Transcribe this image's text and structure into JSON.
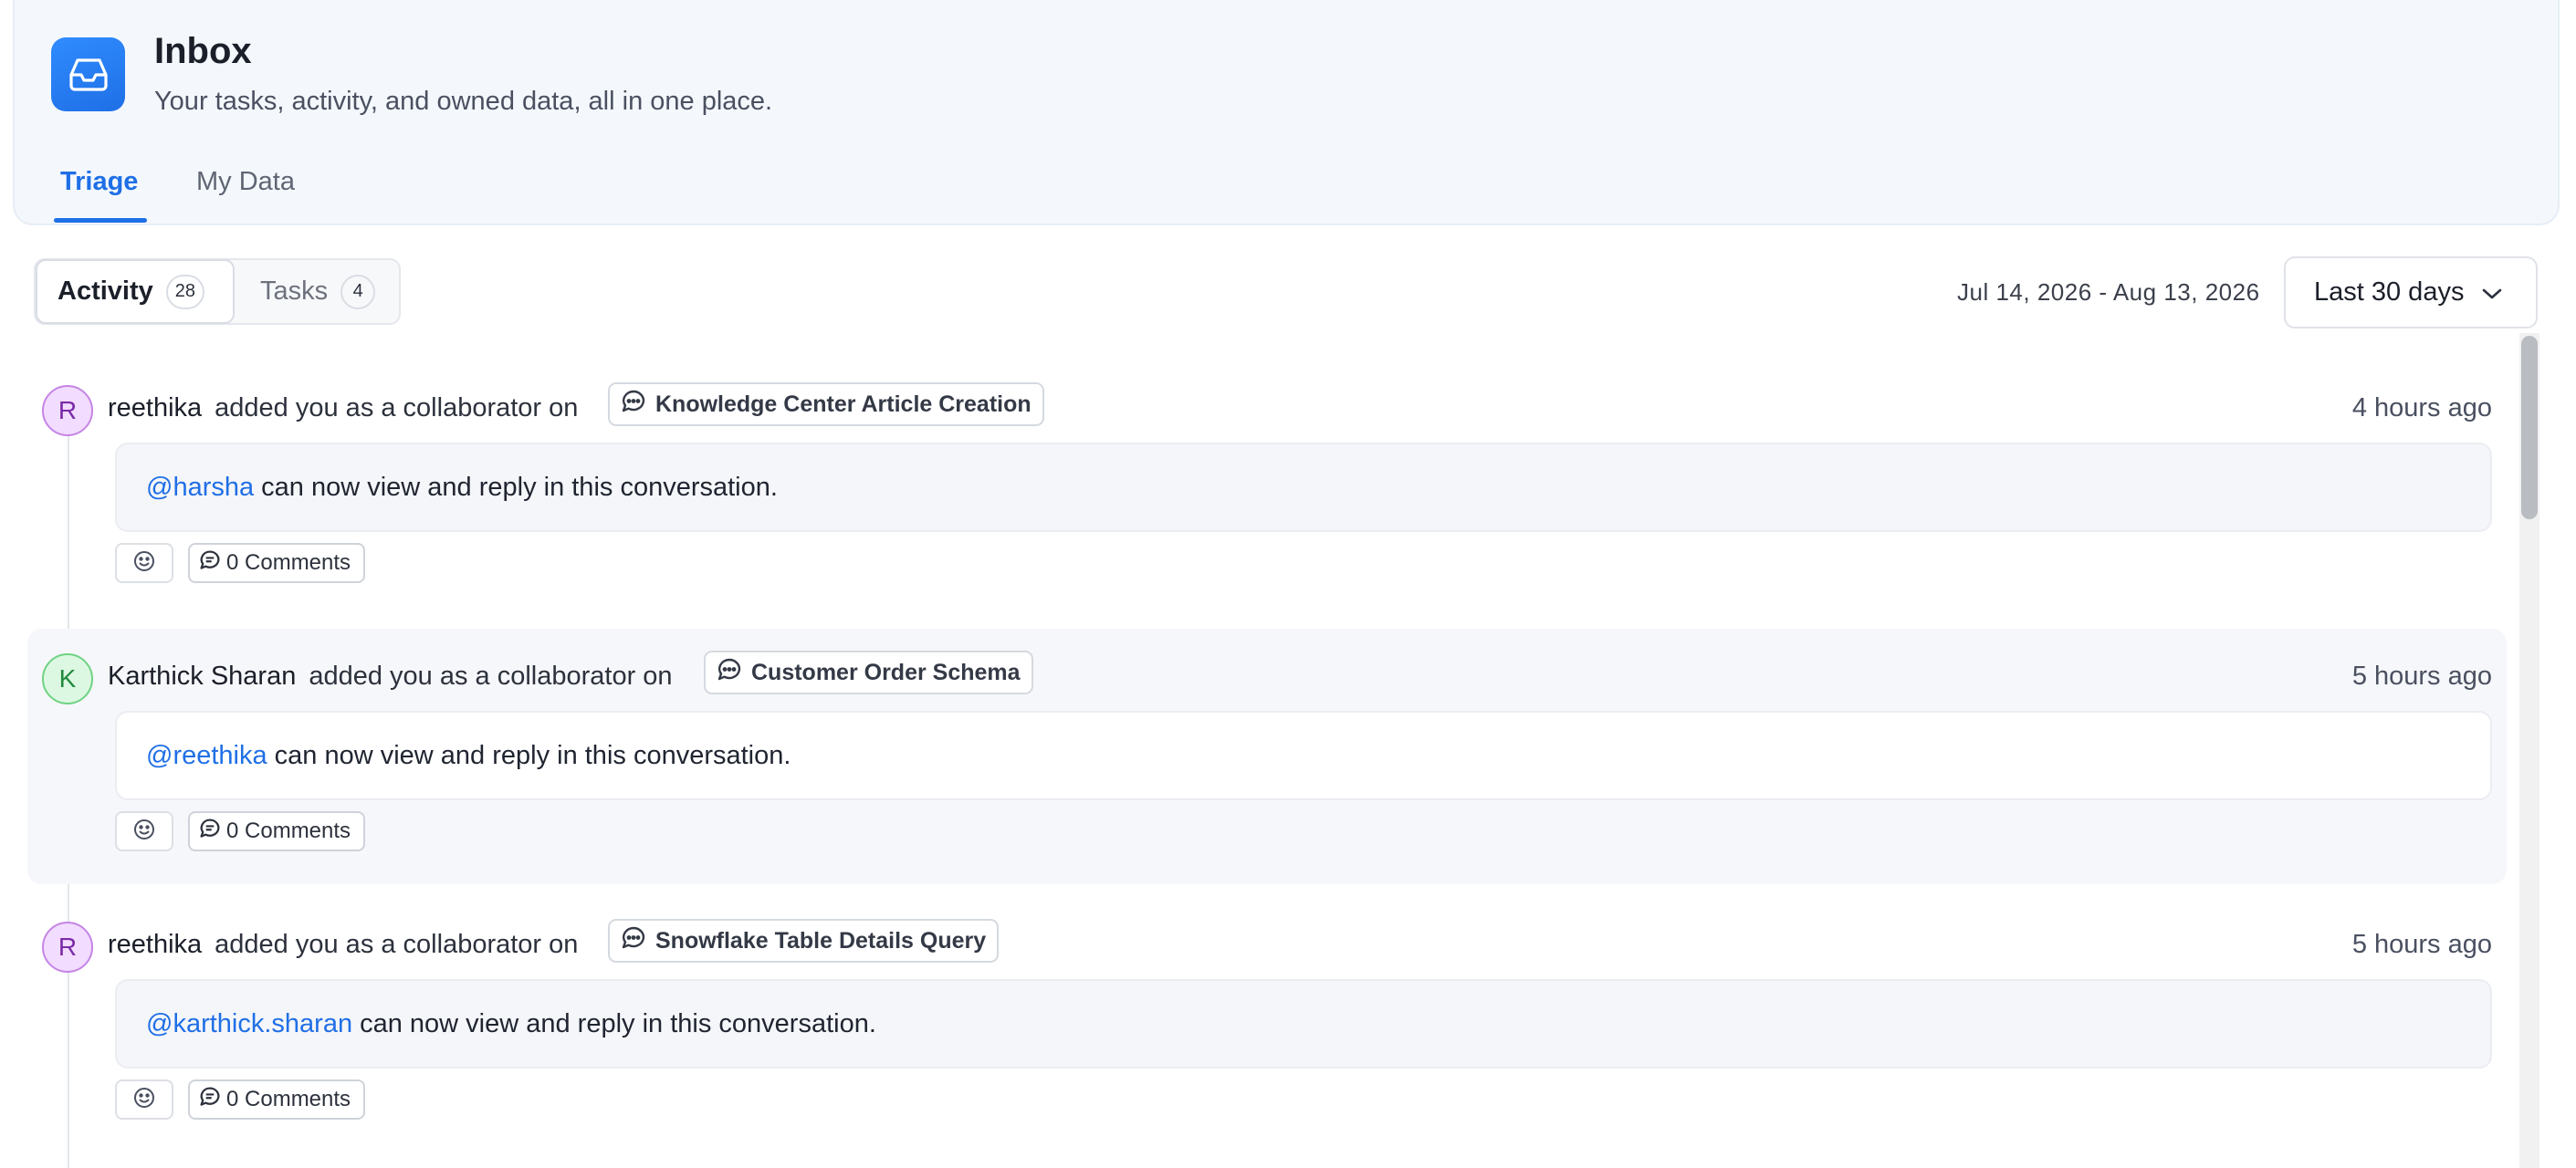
{
  "header": {
    "title": "Inbox",
    "subtitle": "Your tasks, activity, and owned data, all in one place.",
    "icon": "inbox-tray-icon",
    "tabs": [
      {
        "label": "Triage",
        "active": true
      },
      {
        "label": "My Data",
        "active": false
      }
    ]
  },
  "toolbar": {
    "segments": [
      {
        "label": "Activity",
        "count": "28",
        "active": true
      },
      {
        "label": "Tasks",
        "count": "4",
        "active": false
      }
    ],
    "date_range": "Jul 14, 2026 - Aug 13, 2026",
    "range_select": "Last 30 days"
  },
  "feed": [
    {
      "avatar_letter": "R",
      "actor": "reethika",
      "action": "added you as a collaborator on",
      "entity": "Knowledge Center Article Creation",
      "time": "4 hours ago",
      "mention": "@harsha",
      "message": "can now view and reply in this conversation.",
      "comments": "0 Comments"
    },
    {
      "avatar_letter": "K",
      "actor": "Karthick Sharan",
      "action": "added you as a collaborator on",
      "entity": "Customer Order Schema",
      "time": "5 hours ago",
      "mention": "@reethika",
      "message": "can now view and reply in this conversation.",
      "comments": "0 Comments"
    },
    {
      "avatar_letter": "R",
      "actor": "reethika",
      "action": "added you as a collaborator on",
      "entity": "Snowflake Table Details Query",
      "time": "5 hours ago",
      "mention": "@karthick.sharan",
      "message": "can now view and reply in this conversation.",
      "comments": "0 Comments"
    }
  ],
  "colors": {
    "accent": "#1f6fe6",
    "header_bg": "#f4f8fd",
    "avatar_purple": "#f2dcff",
    "avatar_green": "#ddf8e2"
  }
}
